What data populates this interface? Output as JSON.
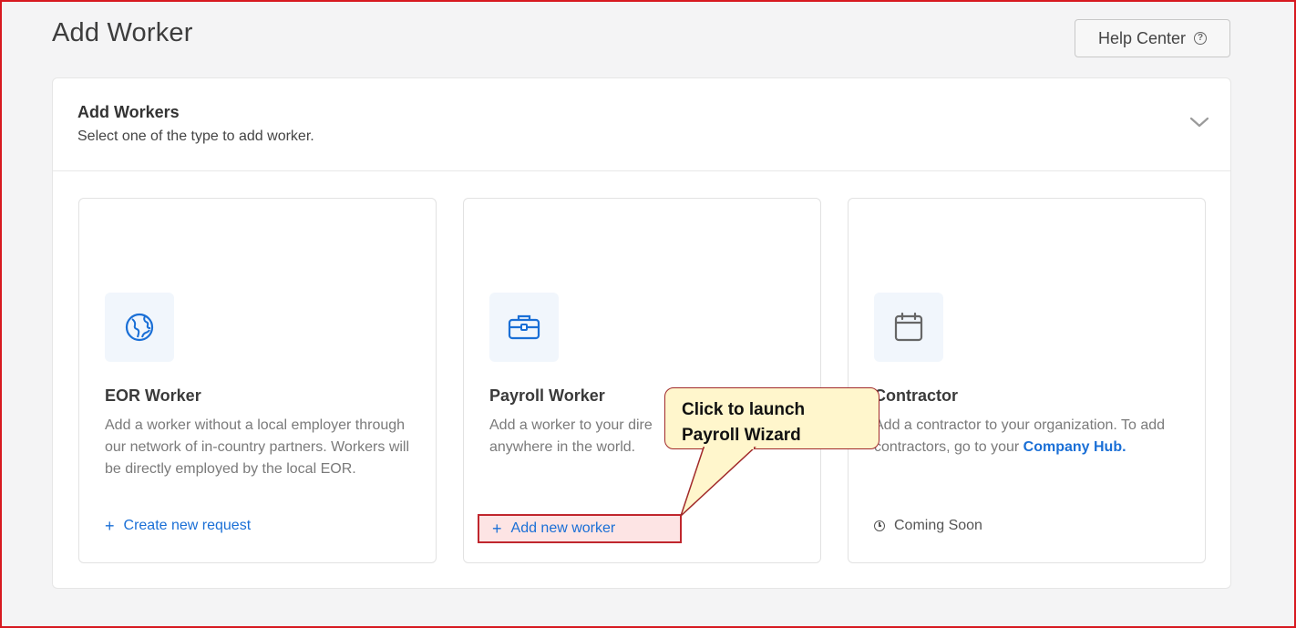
{
  "page": {
    "title": "Add Worker"
  },
  "help": {
    "label": "Help Center",
    "icon": "help-circle-icon"
  },
  "panel": {
    "title": "Add Workers",
    "subtitle": "Select one of the type to add worker."
  },
  "cards": [
    {
      "title": "EOR Worker",
      "description": "Add a worker without a local employer through our network of in-country partners. Workers will be directly employed by the local EOR.",
      "action": "Create new request",
      "icon": "globe-icon"
    },
    {
      "title": "Payroll Worker",
      "description_visible": "Add a worker to your dire",
      "description_line2": "anywhere in the world.",
      "action": "Add new worker",
      "icon": "briefcase-icon"
    },
    {
      "title": "Contractor",
      "description_prefix": "Add a contractor to your organization. To add contractors, go to your",
      "link": "Company Hub.",
      "status": "Coming Soon",
      "icon": "calendar-icon"
    }
  ],
  "callout": {
    "line1": "Click to launch",
    "line2": "Payroll Wizard"
  },
  "colors": {
    "accent": "#1a6fd6",
    "frame": "#d71920",
    "callout_bg": "#fff6cc",
    "highlight_bg": "#fde4e4"
  }
}
